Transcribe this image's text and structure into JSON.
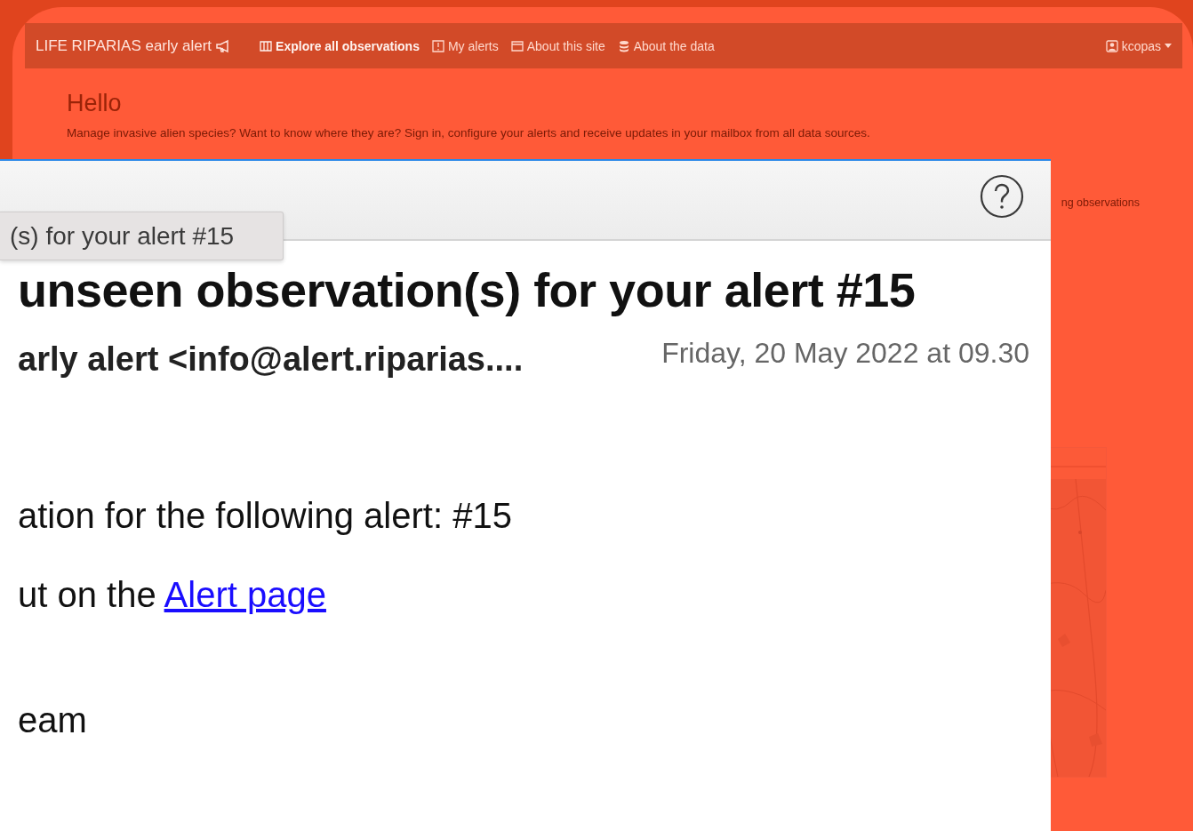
{
  "navbar": {
    "brand": "LIFE RIPARIAS early alert",
    "links": [
      {
        "label": "Explore all observations",
        "selected": true,
        "kind": "columns"
      },
      {
        "label": "My alerts",
        "selected": false,
        "kind": "alert"
      },
      {
        "label": "About this site",
        "selected": false,
        "kind": "window"
      },
      {
        "label": "About the data",
        "selected": false,
        "kind": "database"
      }
    ],
    "user": "kcopas"
  },
  "page": {
    "heading": "Hello",
    "intro": "Manage invasive alien species? Want to know where they are? Sign in, configure your alerts and receive updates in your mailbox from all data sources.",
    "side_text": "ng observations"
  },
  "email": {
    "tooltip": "(s) for your alert #15",
    "subject": "unseen observation(s) for your alert #15",
    "sender": "arly alert <info@alert.riparias....",
    "date": "Friday, 20 May 2022 at 09.30",
    "body": [
      {
        "text": "ation for the following alert: #15"
      },
      {
        "text": "ut on the ",
        "link": "Alert page"
      },
      {
        "text": "eam"
      }
    ]
  }
}
